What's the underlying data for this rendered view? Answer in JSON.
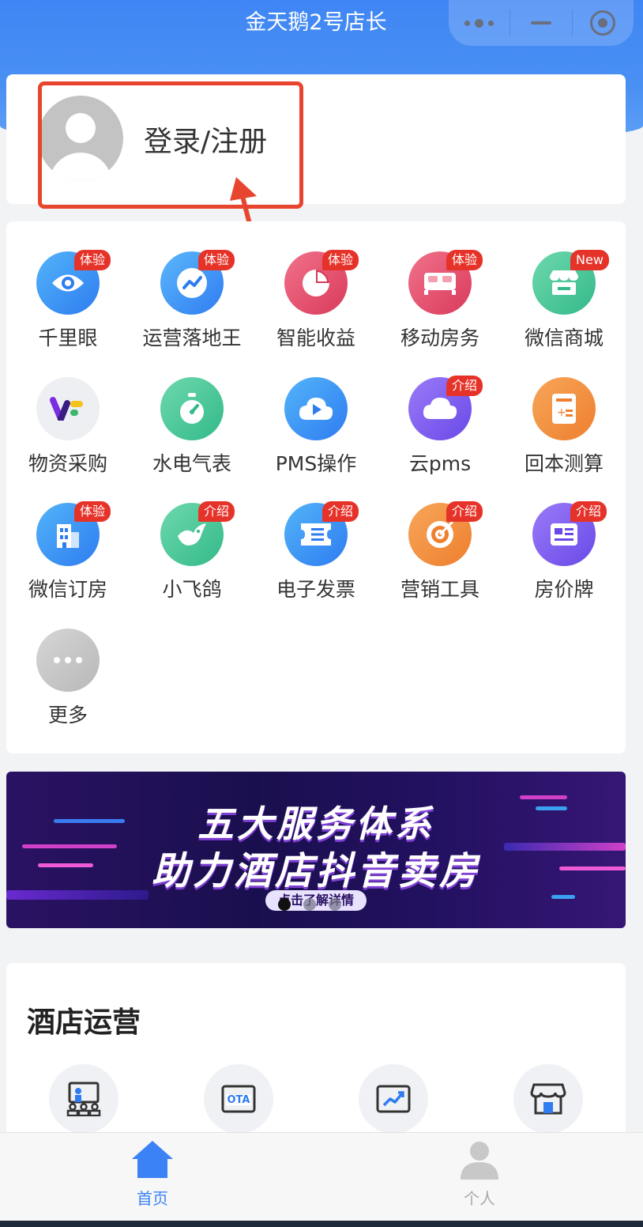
{
  "nav": {
    "title": "金天鹅2号店长"
  },
  "login": {
    "text": "登录/注册"
  },
  "apps": [
    {
      "label": "千里眼",
      "badge": "体验",
      "icon": "eye-icon"
    },
    {
      "label": "运营落地王",
      "badge": "体验",
      "icon": "trend-icon"
    },
    {
      "label": "智能收益",
      "badge": "体验",
      "icon": "pie-chart-icon"
    },
    {
      "label": "移动房务",
      "badge": "体验",
      "icon": "bed-icon"
    },
    {
      "label": "微信商城",
      "badge": "New",
      "icon": "shop-icon"
    },
    {
      "label": "物资采购",
      "badge": "",
      "icon": "purchase-logo-icon"
    },
    {
      "label": "水电气表",
      "badge": "",
      "icon": "meter-icon"
    },
    {
      "label": "PMS操作",
      "badge": "",
      "icon": "play-cloud-icon"
    },
    {
      "label": "云pms",
      "badge": "介绍",
      "icon": "cloud-icon"
    },
    {
      "label": "回本测算",
      "badge": "",
      "icon": "calculator-icon"
    },
    {
      "label": "微信订房",
      "badge": "体验",
      "icon": "building-icon"
    },
    {
      "label": "小飞鸽",
      "badge": "介绍",
      "icon": "bird-icon"
    },
    {
      "label": "电子发票",
      "badge": "介绍",
      "icon": "invoice-icon"
    },
    {
      "label": "营销工具",
      "badge": "介绍",
      "icon": "target-icon"
    },
    {
      "label": "房价牌",
      "badge": "介绍",
      "icon": "price-board-icon"
    },
    {
      "label": "更多",
      "badge": "",
      "icon": "more-icon"
    }
  ],
  "banner": {
    "line1": "五大服务体系",
    "line2": "助力酒店抖音卖房",
    "cta": "点击了解详情"
  },
  "ops": {
    "title": "酒店运营"
  },
  "tabbar": {
    "home": "首页",
    "profile": "个人"
  },
  "colors": {
    "accent": "#3b82f6",
    "badge": "#e6332a",
    "highlight": "#e8452f"
  }
}
